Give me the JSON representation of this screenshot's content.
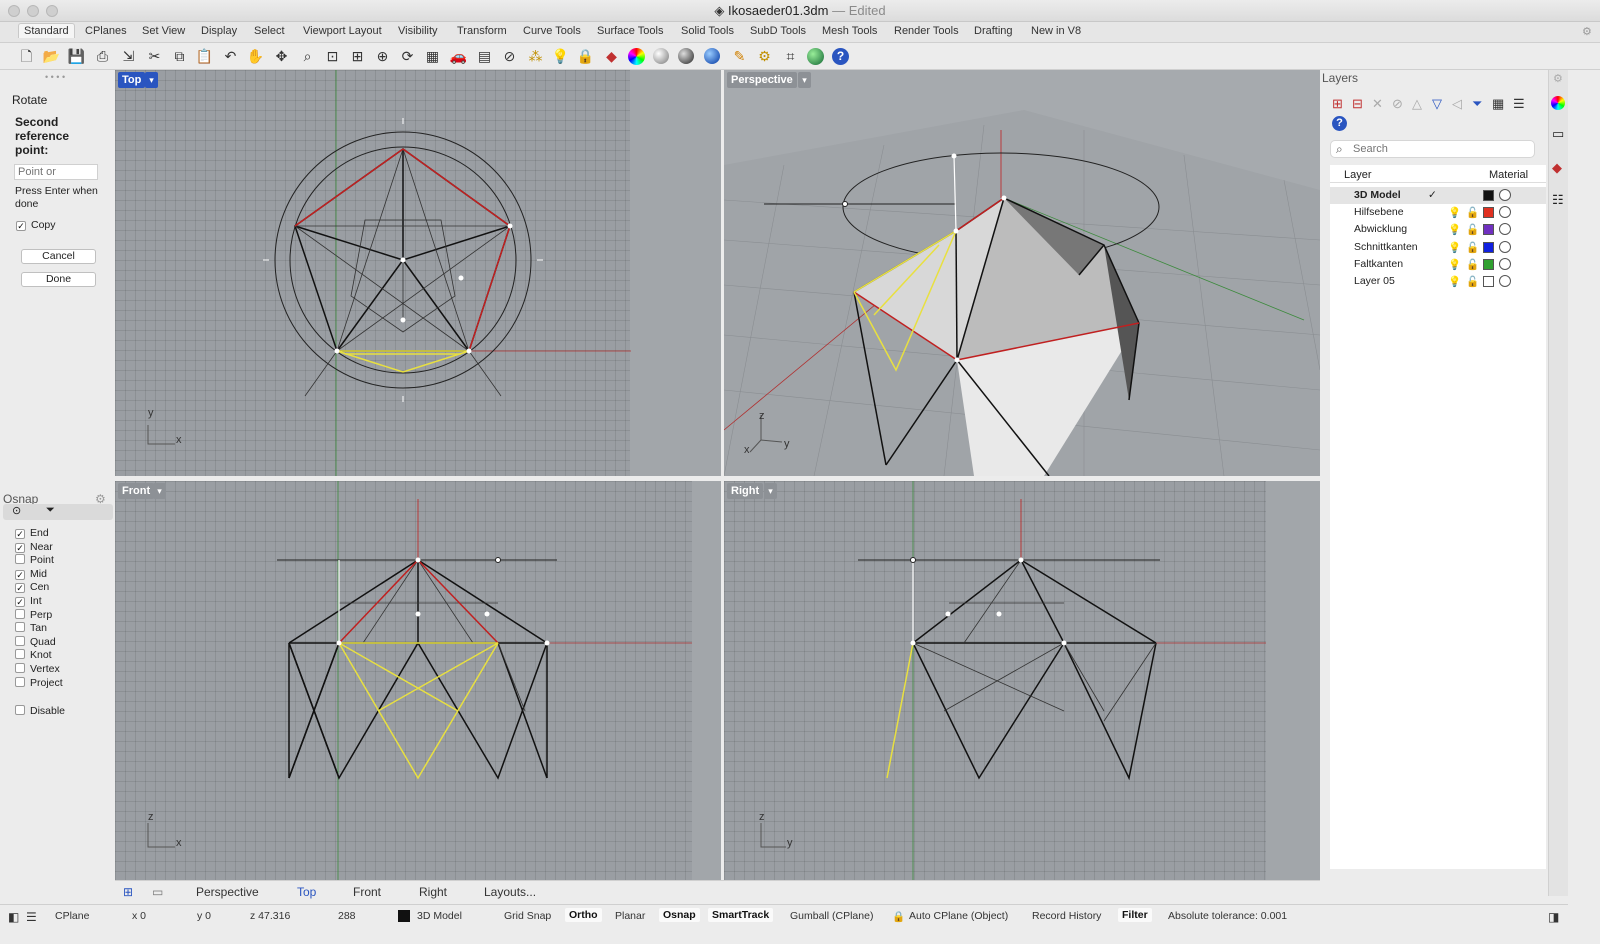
{
  "window": {
    "file": "Ikosaeder01.3dm",
    "separator": "—",
    "state": "Edited"
  },
  "tabs": [
    "Standard",
    "CPlanes",
    "Set View",
    "Display",
    "Select",
    "Viewport Layout",
    "Visibility",
    "Transform",
    "Curve Tools",
    "Surface Tools",
    "Solid Tools",
    "SubD Tools",
    "Mesh Tools",
    "Render Tools",
    "Drafting",
    "New in V8"
  ],
  "toolbar_icons": [
    "new-file-icon",
    "open-folder-icon",
    "save-icon",
    "print-icon",
    "import-icon",
    "cut-icon",
    "copy-icon",
    "paste-icon",
    "undo-icon",
    "pan-hand-icon",
    "rotate-view-icon",
    "zoom-icon",
    "zoom-window-icon",
    "zoom-extents-icon",
    "zoom-selected-icon",
    "rotate-icon",
    "grid-icon",
    "car-icon",
    "mesh-icon",
    "cplane-icon",
    "points-icon",
    "light-icon",
    "lock-icon",
    "layer-icon",
    "color-wheel-icon",
    "shaded-sphere-icon",
    "rendered-sphere-icon",
    "render-icon",
    "blue-sphere-icon",
    "pen-icon",
    "gear-icon",
    "snap-icon",
    "globe-icon",
    "help-icon"
  ],
  "command": {
    "name": "Rotate",
    "prompt": "Second reference point:",
    "input_placeholder": "Point or",
    "hint": "Press Enter when done",
    "copy_label": "Copy",
    "copy_checked": true,
    "cancel": "Cancel",
    "done": "Done"
  },
  "osnap": {
    "title": "Osnap",
    "items": [
      {
        "label": "End",
        "checked": true
      },
      {
        "label": "Near",
        "checked": true
      },
      {
        "label": "Point",
        "checked": false
      },
      {
        "label": "Mid",
        "checked": true
      },
      {
        "label": "Cen",
        "checked": true
      },
      {
        "label": "Int",
        "checked": true
      },
      {
        "label": "Perp",
        "checked": false
      },
      {
        "label": "Tan",
        "checked": false
      },
      {
        "label": "Quad",
        "checked": false
      },
      {
        "label": "Knot",
        "checked": false
      },
      {
        "label": "Vertex",
        "checked": false
      },
      {
        "label": "Project",
        "checked": false
      }
    ],
    "disable": "Disable"
  },
  "viewports": {
    "top": "Top",
    "perspective": "Perspective",
    "front": "Front",
    "right": "Right"
  },
  "axes": {
    "top": [
      "y",
      "x"
    ],
    "perspective": [
      "z",
      "y",
      "x"
    ],
    "front": [
      "z",
      "x"
    ],
    "right": [
      "z",
      "y"
    ]
  },
  "layers": {
    "title": "Layers",
    "search_placeholder": "Search",
    "col_layer": "Layer",
    "col_material": "Material",
    "rows": [
      {
        "name": "3D Model",
        "current": true,
        "color": "#111111"
      },
      {
        "name": "Hilfsebene",
        "color": "#e03020"
      },
      {
        "name": "Abwicklung",
        "color": "#7030c0"
      },
      {
        "name": "Schnittkanten",
        "color": "#1020e0"
      },
      {
        "name": "Faltkanten",
        "color": "#30a030"
      },
      {
        "name": "Layer 05",
        "color": "#ffffff"
      }
    ]
  },
  "view_tabs": [
    "Perspective",
    "Top",
    "Front",
    "Right",
    "Layouts..."
  ],
  "status": {
    "cplane": "CPlane",
    "x": "x 0",
    "y": "y 0",
    "z": "z 47.316",
    "num": "288",
    "layer": "3D Model",
    "grid_snap": "Grid Snap",
    "ortho": "Ortho",
    "planar": "Planar",
    "osnap": "Osnap",
    "smarttrack": "SmartTrack",
    "gumball": "Gumball (CPlane)",
    "auto_cplane": "Auto CPlane (Object)",
    "record_history": "Record History",
    "filter": "Filter",
    "tolerance": "Absolute tolerance: 0.001"
  }
}
